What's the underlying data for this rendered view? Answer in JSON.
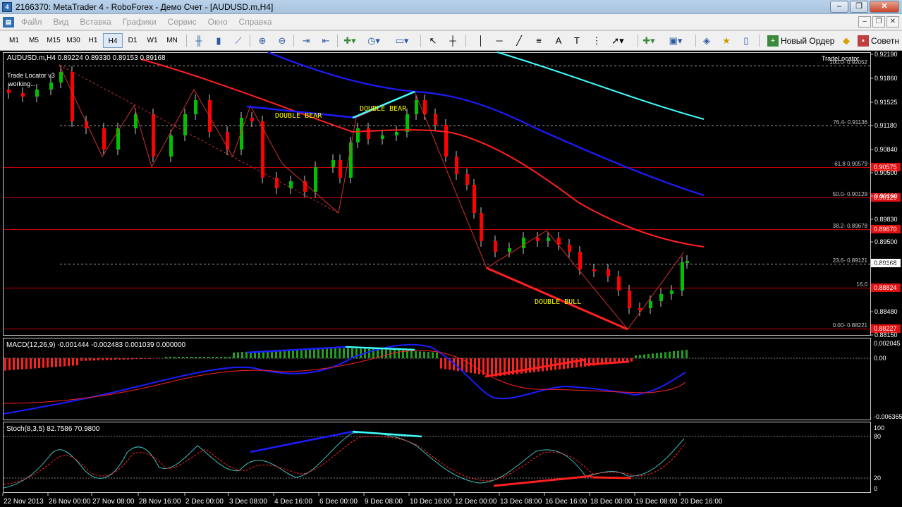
{
  "window": {
    "title": "2166370: MetaTrader 4 - RoboForex - Демо Счет - [AUDUSD.m,H4]",
    "app_icon": "metatrader-icon"
  },
  "menu": {
    "items": [
      "Файл",
      "Вид",
      "Вставка",
      "Графики",
      "Сервис",
      "Окно",
      "Справка"
    ]
  },
  "toolbar": {
    "timeframes": [
      "M1",
      "M5",
      "M15",
      "M30",
      "H1",
      "H4",
      "D1",
      "W1",
      "MN"
    ],
    "active_timeframe": "H4",
    "new_order_label": "Новый Ордер",
    "advisors_label": "Советн"
  },
  "chart": {
    "symbol_info": "AUDUSD.m,H4  0.89224 0.89330 0.89153 0.89168",
    "trade_locator_status": "Trade Locator v3",
    "trade_locator_working": "working...",
    "trade_locator_name": "TradeLocator",
    "pattern_labels": [
      "DOUBLE BEAR",
      "DOUBLE BEAR",
      "DOUBLE BULL"
    ],
    "price_axis_labels": [
      "0.92190",
      "0.91860",
      "0.91525",
      "0.91180",
      "0.90840",
      "0.90500",
      "0.90160",
      "0.89830",
      "0.89500",
      "0.89150",
      "0.88480",
      "0.88150"
    ],
    "fib_levels": [
      {
        "label": "100.0- 0.92052",
        "axis": ""
      },
      {
        "label": "76.4- 0.91136",
        "axis": ""
      },
      {
        "label": "61.8 0.90579",
        "axis": "0.90575"
      },
      {
        "label": "50.0- 0.90129",
        "axis": "0.90129"
      },
      {
        "label": "38.2- 0.89678",
        "axis": "0.89670"
      },
      {
        "label": "23.6- 0.89121",
        "axis": ""
      },
      {
        "label": "16.0",
        "axis": "0.88824"
      },
      {
        "label": "0.00- 0.88221",
        "axis": "0.88227"
      }
    ],
    "current_price": "0.89168",
    "colors": {
      "background": "#000000",
      "bull_candle": "#00c000",
      "bear_candle": "#ff0000",
      "ma_red": "#ff2020",
      "ma_blue": "#1c1cff",
      "ma_cyan": "#40ffff",
      "level_line": "#c00000"
    }
  },
  "macd": {
    "title": "MACD(12,26,9) -0.001444 -0.002483 0.001039 0.000000",
    "axis_labels": [
      "0.002045",
      "0.00",
      "-0.006365"
    ]
  },
  "stoch": {
    "title": "Stoch(8,3,5) 82.7586 70.9800",
    "axis_labels": [
      "100",
      "80",
      "20",
      "0"
    ]
  },
  "time_axis": [
    "22 Nov 2013",
    "26 Nov 00:00",
    "27 Nov 08:00",
    "28 Nov 16:00",
    "2 Dec 00:00",
    "3 Dec 08:00",
    "4 Dec 16:00",
    "6 Dec 00:00",
    "9 Dec 08:00",
    "10 Dec 16:00",
    "12 Dec 00:00",
    "13 Dec 08:00",
    "16 Dec 16:00",
    "18 Dec 00:00",
    "19 Dec 08:00",
    "20 Dec 16:00"
  ]
}
